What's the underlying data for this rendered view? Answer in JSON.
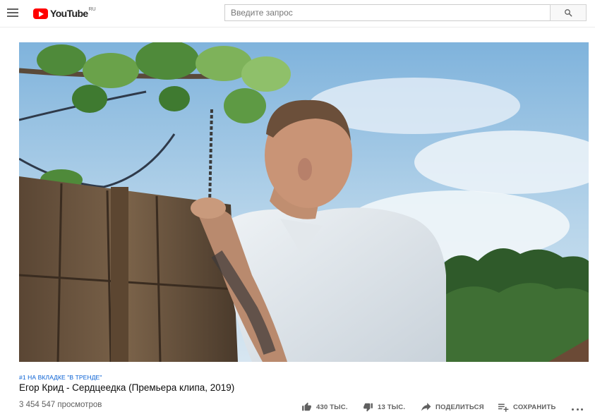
{
  "header": {
    "logo_text": "YouTube",
    "logo_region": "RU",
    "search_placeholder": "Введите запрос"
  },
  "video": {
    "trending_badge": "#1 НА ВКЛАДКЕ \"В ТРЕНДЕ\"",
    "title": "Егор Крид - Сердцеедка (Премьера клипа, 2019)",
    "views": "3 454 547 просмотров"
  },
  "actions": {
    "like_count": "430 ТЫС.",
    "dislike_count": "13 ТЫС.",
    "share_label": "ПОДЕЛИТЬСЯ",
    "save_label": "СОХРАНИТЬ"
  },
  "colors": {
    "brand_red": "#ff0000",
    "link_blue": "#065fd4",
    "secondary_text": "#606060"
  },
  "icons": [
    "menu-icon",
    "youtube-logo-icon",
    "search-icon",
    "thumb-up-icon",
    "thumb-down-icon",
    "share-icon",
    "playlist-add-icon",
    "more-icon"
  ]
}
